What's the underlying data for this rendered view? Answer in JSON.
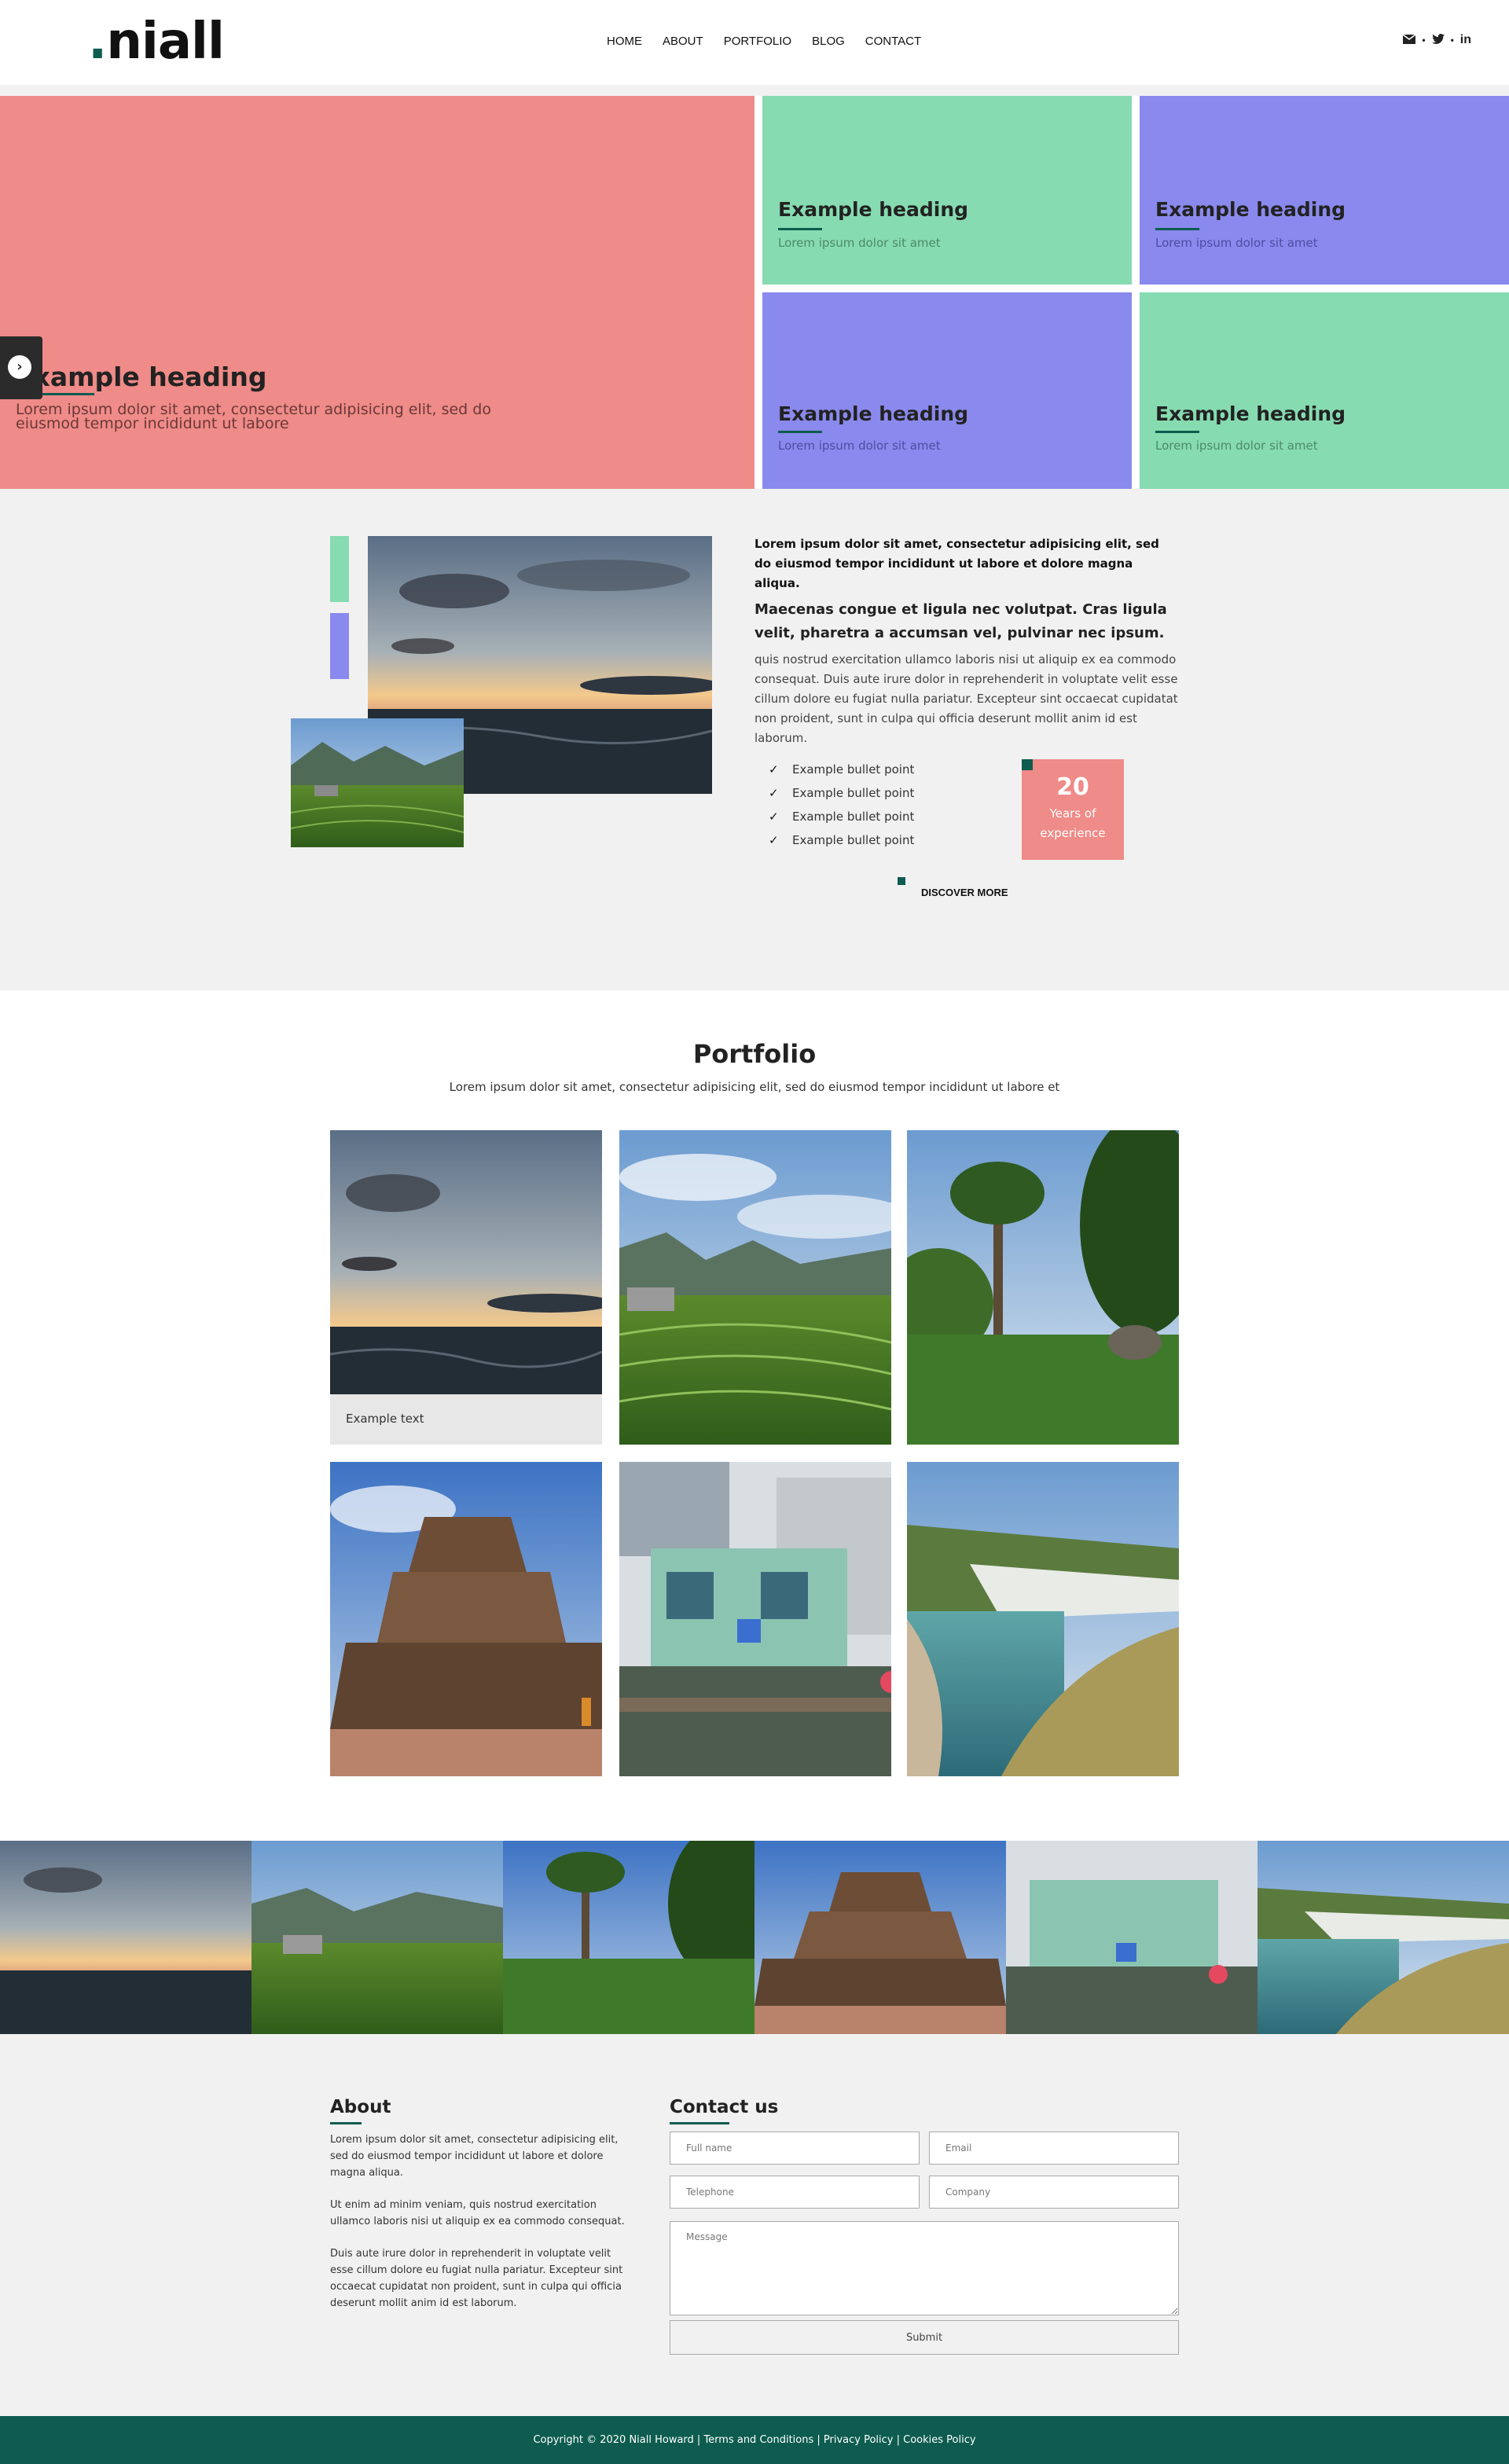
{
  "header": {
    "logo_dot": ".",
    "logo_text": "niall",
    "nav": [
      "HOME",
      "ABOUT",
      "PORTFOLIO",
      "BLOG",
      "CONTACT"
    ],
    "social_sep": "•"
  },
  "hero": {
    "main": {
      "heading": "Example heading",
      "text": "Lorem ipsum dolor sit amet, consectetur adipisicing elit, sed do eiusmod tempor incididunt ut labore"
    },
    "tiles": [
      {
        "heading": "Example heading",
        "text": "Lorem ipsum dolor sit amet"
      },
      {
        "heading": "Example heading",
        "text": "Lorem ipsum dolor sit amet"
      },
      {
        "heading": "Example heading",
        "text": "Lorem ipsum dolor sit amet"
      },
      {
        "heading": "Example heading",
        "text": "Lorem ipsum dolor sit amet"
      }
    ],
    "handle_icon": "›"
  },
  "about": {
    "lead": "Lorem ipsum dolor sit amet, consectetur adipisicing elit, sed do eiusmod tempor incididunt ut labore et dolore magna aliqua.",
    "sub": "Maecenas congue et ligula nec volutpat. Cras ligula velit, pharetra a accumsan vel, pulvinar nec ipsum.",
    "body": "quis nostrud exercitation ullamco laboris nisi ut aliquip ex ea commodo consequat. Duis aute irure dolor in reprehenderit in voluptate velit esse cillum dolore eu fugiat nulla pariatur. Excepteur sint occaecat cupidatat non proident, sunt in culpa qui officia deserunt mollit anim id est laborum.",
    "bullets": [
      "Example bullet point",
      "Example bullet point",
      "Example bullet point",
      "Example bullet point"
    ],
    "check": "✓",
    "experience": {
      "number": "20",
      "label1": "Years of",
      "label2": "experience"
    },
    "discover": "DISCOVER MORE"
  },
  "portfolio": {
    "title": "Portfolio",
    "subtitle": "Lorem ipsum dolor sit amet, consectetur adipisicing elit, sed do eiusmod tempor incididunt ut labore et",
    "caption": "Example text"
  },
  "footer": {
    "about_title": "About",
    "about_paragraphs": [
      "Lorem ipsum dolor sit amet, consectetur adipisicing elit, sed do eiusmod tempor incididunt ut labore et dolore magna aliqua.",
      "Ut enim ad minim veniam, quis nostrud exercitation ullamco laboris nisi ut aliquip ex ea commodo consequat.",
      "Duis aute irure dolor in reprehenderit in voluptate velit esse cillum dolore eu fugiat nulla pariatur. Excepteur sint occaecat cupidatat non proident, sunt in culpa qui officia deserunt mollit anim id est laborum."
    ],
    "contact_title": "Contact us",
    "placeholders": {
      "name": "Full name",
      "email": "Email",
      "telephone": "Telephone",
      "company": "Company",
      "message": "Message"
    },
    "submit": "Submit",
    "copyright": "Copyright © 2020 Niall Howard | Terms and Conditions | Privacy Policy | Cookies Policy"
  },
  "colors": {
    "coral": "#ef8b88",
    "mint": "#86dbb0",
    "violet": "#8a89ed",
    "brand": "#0d5c4f",
    "grey": "#f1f1f1"
  },
  "icons": [
    "envelope-icon",
    "twitter-icon",
    "linkedin-icon",
    "arrow-right-icon",
    "check-icon"
  ]
}
